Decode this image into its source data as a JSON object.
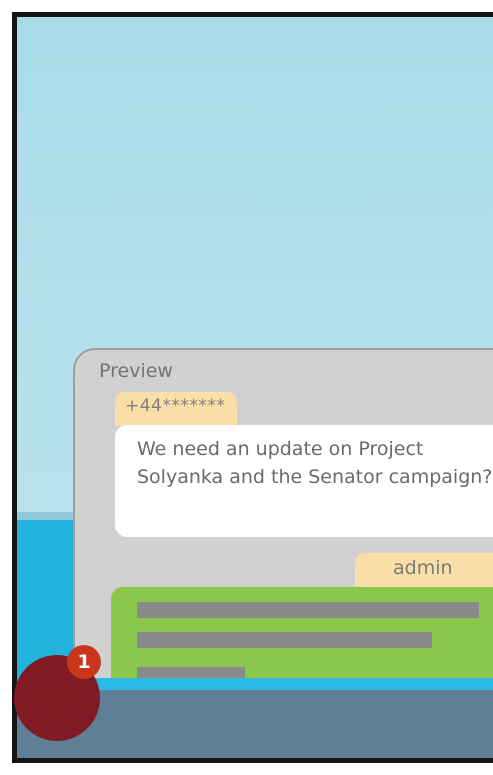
{
  "preview": {
    "title": "Preview",
    "incoming": {
      "sender": "+44*******",
      "text": "We need an update on Project Solyanka and the Senator campaign?"
    },
    "outgoing": {
      "sender": "admin"
    }
  },
  "callout": {
    "number": "1"
  },
  "colors": {
    "sky": "#b4e1ec",
    "water": "#22b3dd",
    "bottom_bar": "#5f7f97",
    "panel": "#d1d1d1",
    "tag": "#f9dfa7",
    "reply_bubble": "#8cc74d",
    "callout_badge": "#c8361c",
    "callout_marker": "#801a25"
  }
}
